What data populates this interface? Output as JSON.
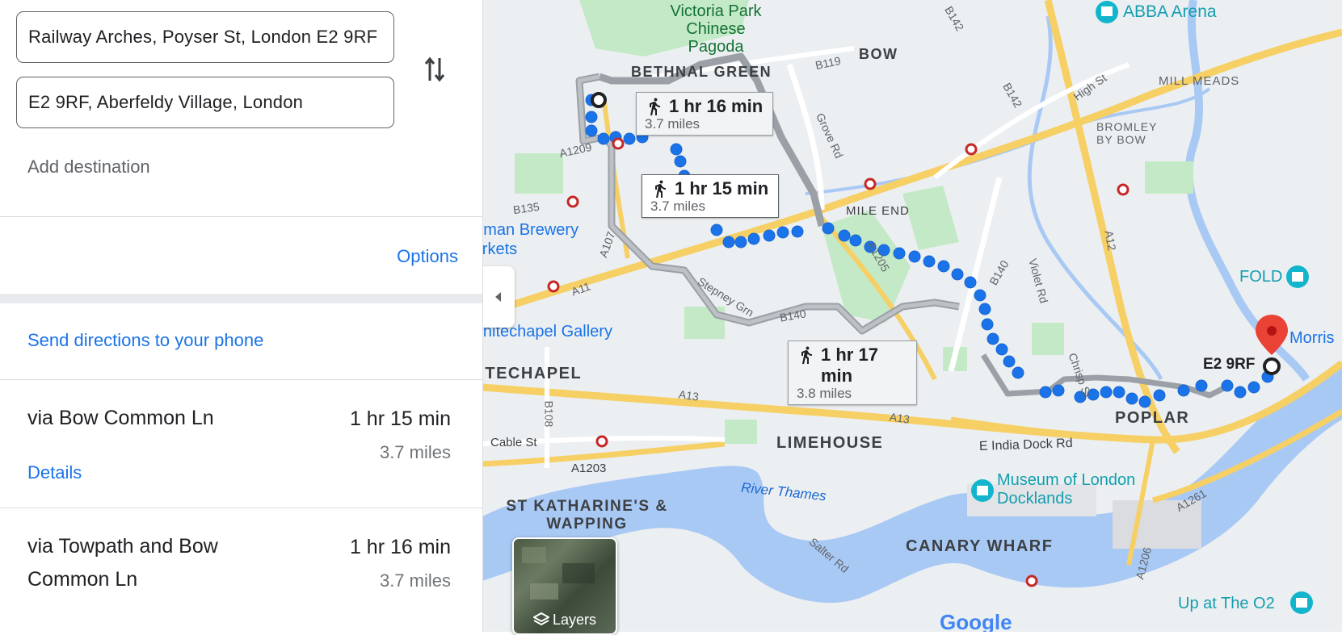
{
  "directions": {
    "origin_value": "Railway Arches, Poyser St, London E2 9RF",
    "destination_value": "E2 9RF, Aberfeldy Village, London",
    "swap_icon": "swap-vertical-icon",
    "add_destination": "Add destination",
    "options_label": "Options",
    "send_to_phone": "Send directions to your phone"
  },
  "routes": [
    {
      "name": "via Bow Common Ln",
      "time": "1 hr 15 min",
      "distance": "3.7 miles",
      "details_label": "Details"
    },
    {
      "name": "via Towpath and Bow Common Ln",
      "time": "1 hr 16 min",
      "distance": "3.7 miles"
    }
  ],
  "map": {
    "callouts": [
      {
        "time": "1 hr 16 min",
        "distance": "3.7 miles"
      },
      {
        "time": "1 hr 15 min",
        "distance": "3.7 miles"
      },
      {
        "time": "1 hr 17 min",
        "distance": "3.8 miles"
      }
    ],
    "labels": {
      "victoria_park": "Victoria Park Chinese Pagoda",
      "bethnal_green": "BETHNAL GREEN",
      "bow": "BOW",
      "abba": "ABBA Arena",
      "mill_meads": "MILL MEADS",
      "bromley": "BROMLEY BY BOW",
      "mile_end": "MILE END",
      "truman": "Truman Brewery Markets",
      "whitechapel_gallery": "Whitechapel Gallery",
      "whitechapel": "WHITECHAPEL",
      "limehouse": "LIMEHOUSE",
      "poplar": "POPLAR",
      "st_katharine": "ST KATHARINE'S & WAPPING",
      "canary": "CANARY WHARF",
      "museum": "Museum of London Docklands",
      "river": "River Thames",
      "fold": "FOLD",
      "morris": "Morris",
      "up_o2": "Up at The O2",
      "dest_marker": "E2 9RF",
      "google": "Google",
      "layers": "Layers"
    },
    "roads": {
      "b142a": "B142",
      "b119": "B119",
      "high_st": "High St",
      "b142b": "B142",
      "grove_rd": "Grove Rd",
      "a1209": "A1209",
      "b135": "B135",
      "a107": "A107",
      "a1205": "A1205",
      "b140a": "B140",
      "violet_rd": "Violet Rd",
      "a12": "A12",
      "a11": "A11",
      "stepney": "Stepney Grn",
      "b140b": "B140",
      "chrisp": "Chrisp St",
      "a13a": "A13",
      "a13b": "A13",
      "b108": "B108",
      "cable_st": "Cable St",
      "a1203": "A1203",
      "e_india": "E India Dock Rd",
      "a1261": "A1261",
      "a1206": "A1206",
      "salter": "Salter Rd"
    }
  }
}
